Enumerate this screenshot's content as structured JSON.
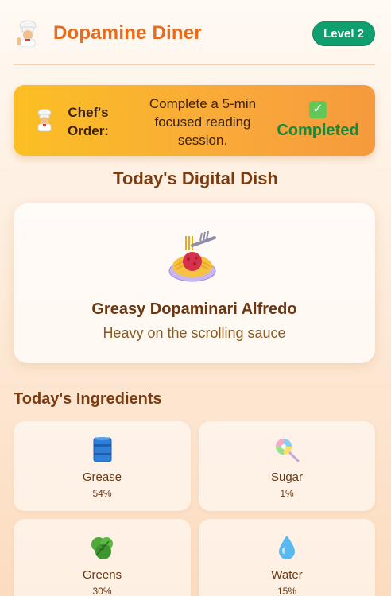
{
  "header": {
    "title": "Dopamine Diner",
    "level": "Level 2",
    "icon": "chef-icon"
  },
  "order": {
    "label": "Chef's Order:",
    "text": "Complete a 5-min focused reading session.",
    "status": "Completed",
    "icon": "check-icon"
  },
  "dish": {
    "section_title": "Today's Digital Dish",
    "name": "Greasy Dopaminari Alfredo",
    "description": "Heavy on the scrolling sauce",
    "icon": "spaghetti-icon"
  },
  "ingredients": {
    "title": "Today's Ingredients",
    "items": [
      {
        "name": "Grease",
        "percent": "54%",
        "icon": "oil-barrel-icon"
      },
      {
        "name": "Sugar",
        "percent": "1%",
        "icon": "lollipop-icon"
      },
      {
        "name": "Greens",
        "percent": "30%",
        "icon": "leafy-greens-icon"
      },
      {
        "name": "Water",
        "percent": "15%",
        "icon": "droplet-icon"
      }
    ]
  },
  "colors": {
    "accent": "#ea6a1c",
    "badge": "#0f9f6e",
    "success": "#178a3a"
  }
}
